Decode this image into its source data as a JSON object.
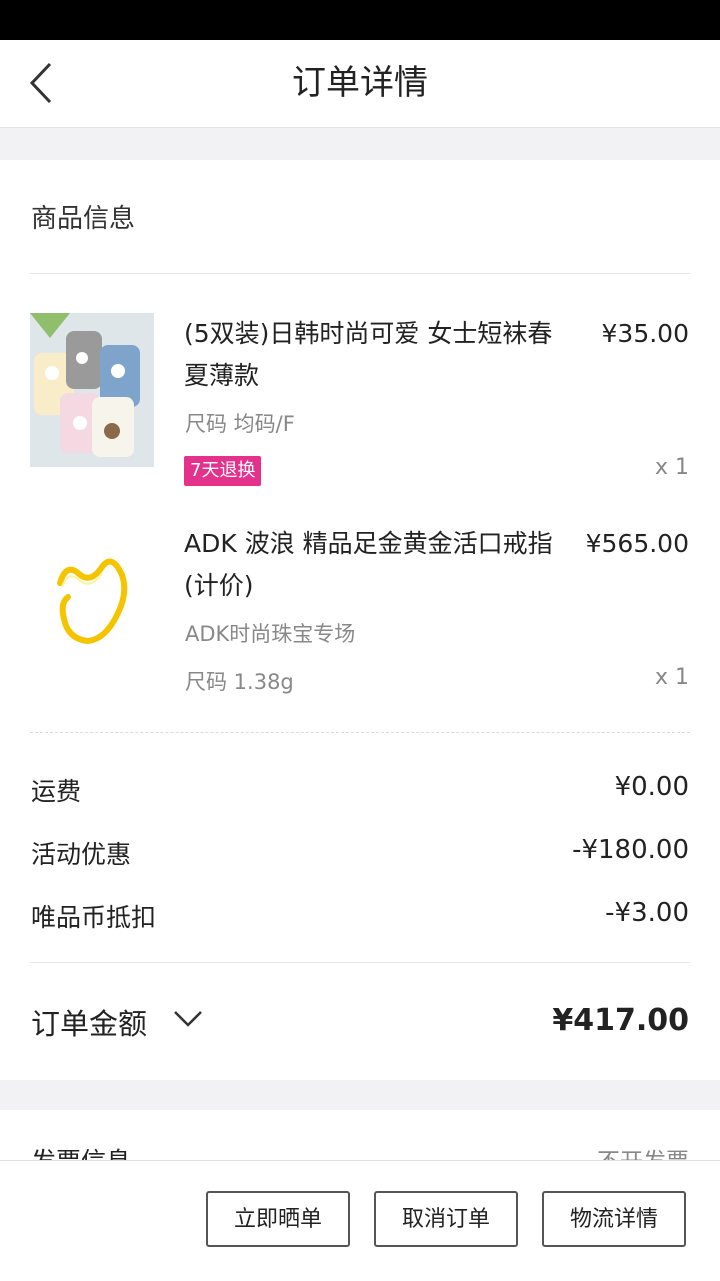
{
  "nav": {
    "title": "订单详情",
    "back_icon": "chevron-left-icon"
  },
  "goods": {
    "section_title": "商品信息",
    "items": [
      {
        "name": "(5双装)日韩时尚可爱 女士短袜春夏薄款",
        "price": "¥35.00",
        "size": "尺码 均码/F",
        "tag": "7天退换",
        "qty": "x 1"
      },
      {
        "name": "ADK 波浪 精品足金黄金活口戒指(计价)",
        "price": "¥565.00",
        "store": "ADK时尚珠宝专场",
        "size": "尺码 1.38g",
        "qty": "x 1"
      }
    ]
  },
  "fees": [
    {
      "label": "运费",
      "value": "¥0.00"
    },
    {
      "label": "活动优惠",
      "value": "-¥180.00"
    },
    {
      "label": "唯品币抵扣",
      "value": "-¥3.00"
    }
  ],
  "total": {
    "label": "订单金额",
    "value": "¥417.00",
    "icon": "chevron-down-icon"
  },
  "invoice": {
    "label": "发票信息",
    "value": "不开发票"
  },
  "actions": {
    "share": "立即晒单",
    "cancel": "取消订单",
    "logistics": "物流详情"
  },
  "colors": {
    "tag_bg": "#e4318c",
    "gold": "#f5c400"
  }
}
